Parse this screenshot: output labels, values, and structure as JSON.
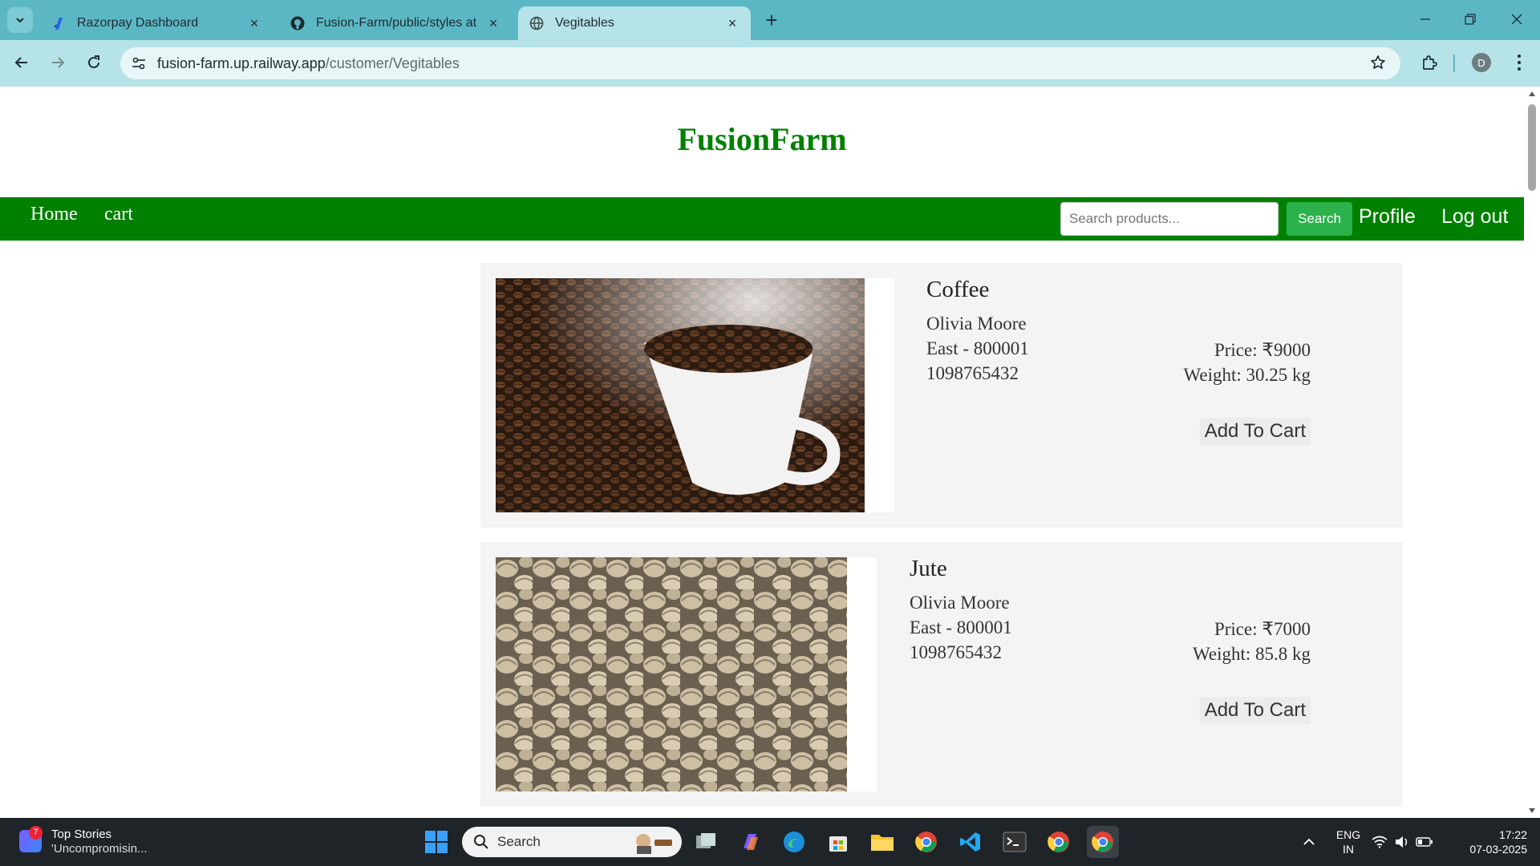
{
  "browser": {
    "tabs": [
      {
        "title": "Razorpay Dashboard",
        "active": false
      },
      {
        "title": "Fusion-Farm/public/styles at ma",
        "active": false
      },
      {
        "title": "Vegitables",
        "active": true
      }
    ],
    "url_host": "fusion-farm.up.railway.app",
    "url_path": "/customer/Vegitables",
    "profile_initial": "D"
  },
  "site": {
    "title": "FusionFarm",
    "nav": {
      "home": "Home",
      "cart": "cart",
      "search_placeholder": "Search products...",
      "search_button": "Search",
      "profile": "Profile",
      "logout": "Log out"
    }
  },
  "products": [
    {
      "name": "Coffee",
      "seller": "Olivia Moore",
      "location": "East - 800001",
      "phone": "1098765432",
      "price": "Price: ₹9000",
      "weight": "Weight: 30.25 kg",
      "button": "Add To Cart"
    },
    {
      "name": "Jute",
      "seller": "Olivia Moore",
      "location": "East - 800001",
      "phone": "1098765432",
      "price": "Price: ₹7000",
      "weight": "Weight: 85.8 kg",
      "button": "Add To Cart"
    }
  ],
  "taskbar": {
    "news_badge": "7",
    "news_title": "Top Stories",
    "news_subtitle": "'Uncompromisin...",
    "search_label": "Search",
    "lang_1": "ENG",
    "lang_2": "IN",
    "time": "17:22",
    "date": "07-03-2025"
  },
  "colors": {
    "brand_green": "#008000",
    "search_button": "#2bb24c",
    "chrome_accent": "#5bb7c4"
  }
}
